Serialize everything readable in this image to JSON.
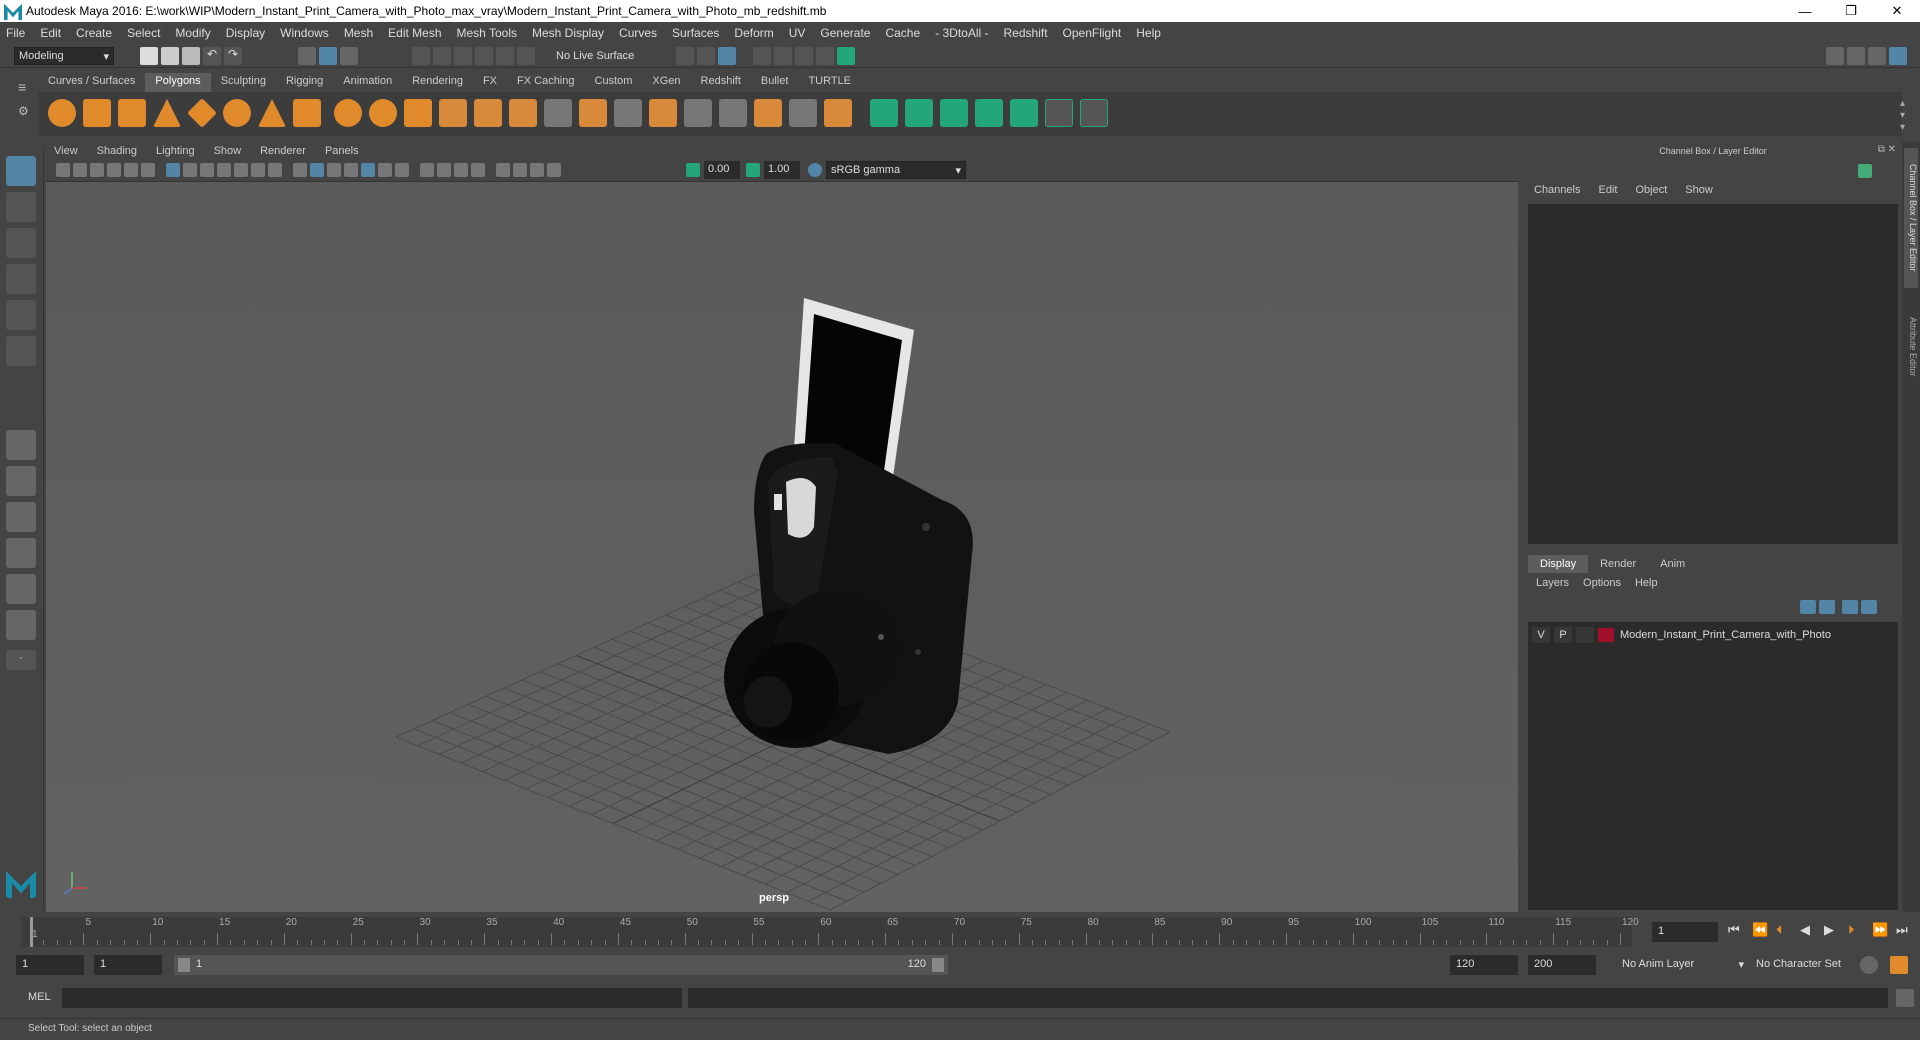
{
  "window": {
    "title": "Autodesk Maya 2016: E:\\work\\WIP\\Modern_Instant_Print_Camera_with_Photo_max_vray\\Modern_Instant_Print_Camera_with_Photo_mb_redshift.mb",
    "minimize": "—",
    "restore": "❐",
    "close": "✕"
  },
  "menubar": [
    "File",
    "Edit",
    "Create",
    "Select",
    "Modify",
    "Display",
    "Windows",
    "Mesh",
    "Edit Mesh",
    "Mesh Tools",
    "Mesh Display",
    "Curves",
    "Surfaces",
    "Deform",
    "UV",
    "Generate",
    "Cache",
    "- 3DtoAll -",
    "Redshift",
    "OpenFlight",
    "Help"
  ],
  "statusline": {
    "mode": "Modeling",
    "live_surface": "No Live Surface"
  },
  "shelf": {
    "tabs": [
      "Curves / Surfaces",
      "Polygons",
      "Sculpting",
      "Rigging",
      "Animation",
      "Rendering",
      "FX",
      "FX Caching",
      "Custom",
      "XGen",
      "Redshift",
      "Bullet",
      "TURTLE"
    ],
    "active_tab": "Polygons"
  },
  "viewport": {
    "menu": [
      "View",
      "Shading",
      "Lighting",
      "Show",
      "Renderer",
      "Panels"
    ],
    "exposure": "0.00",
    "gamma": "1.00",
    "color_space": "sRGB gamma",
    "camera_label": "persp"
  },
  "channel_box": {
    "title": "Channel Box / Layer Editor",
    "menu": [
      "Channels",
      "Edit",
      "Object",
      "Show"
    ]
  },
  "layer_editor": {
    "tabs": [
      "Display",
      "Render",
      "Anim"
    ],
    "active_tab": "Display",
    "menu": [
      "Layers",
      "Options",
      "Help"
    ],
    "layers": [
      {
        "v": "V",
        "p": "P",
        "name": "Modern_Instant_Print_Camera_with_Photo",
        "color": "#a0102a"
      }
    ]
  },
  "side_tabs": [
    "Channel Box / Layer Editor",
    "Attribute Editor"
  ],
  "timeslider": {
    "ticks": [
      "5",
      "10",
      "15",
      "20",
      "25",
      "30",
      "35",
      "40",
      "45",
      "50",
      "55",
      "60",
      "65",
      "70",
      "75",
      "80",
      "85",
      "90",
      "95",
      "100",
      "105",
      "110",
      "115",
      "120"
    ],
    "start_label": "1",
    "current_frame": "1"
  },
  "rangebar": {
    "start": "1",
    "playback_start": "1",
    "range_start_label": "1",
    "range_end_label": "120",
    "playback_end": "120",
    "end": "200",
    "anim_layer": "No Anim Layer",
    "character_set": "No Character Set"
  },
  "cmdline": {
    "label": "MEL"
  },
  "helpline": {
    "text": "Select Tool: select an object"
  },
  "colors": {
    "accent": "#5285a6",
    "shelf_orange": "#e08a2c",
    "shelf_green": "#22a67a",
    "layer_color": "#a0102a"
  }
}
